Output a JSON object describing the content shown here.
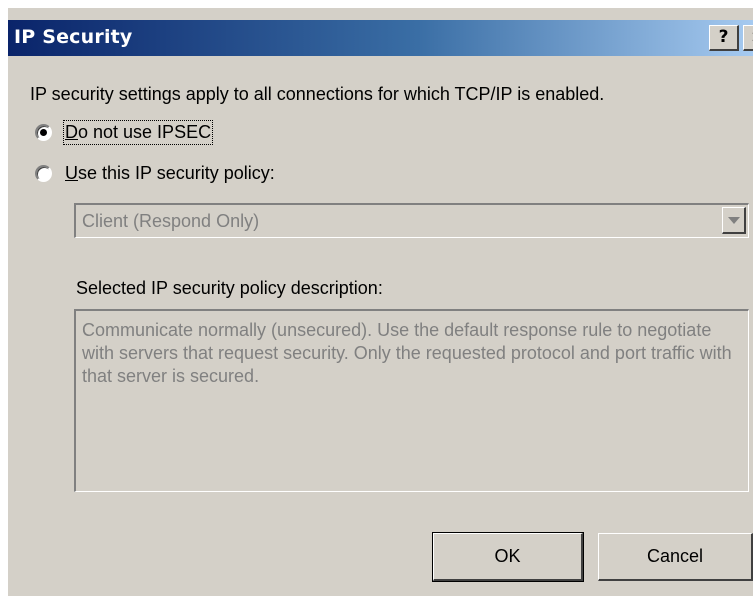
{
  "window": {
    "title": "IP Security",
    "help_label": "?",
    "close_label": "×"
  },
  "intro_text": "IP security settings apply to all connections for which TCP/IP is enabled.",
  "options": {
    "no_ipsec": {
      "label_accel": "D",
      "label_rest": "o not use IPSEC",
      "selected": true
    },
    "use_policy": {
      "label_accel": "U",
      "label_rest": "se this IP security policy:",
      "selected": false
    }
  },
  "policy_select": {
    "value": "Client (Respond Only)",
    "enabled": false
  },
  "description": {
    "label": "Selected IP security policy description:",
    "text": "Communicate normally (unsecured). Use the default response rule to negotiate with servers that request security. Only the requested protocol and port traffic with that server is secured."
  },
  "buttons": {
    "ok": "OK",
    "cancel": "Cancel"
  },
  "colors": {
    "face": "#d4d0c8",
    "title_start": "#0a246a",
    "title_end": "#a6caf0",
    "disabled_text": "#808080"
  }
}
